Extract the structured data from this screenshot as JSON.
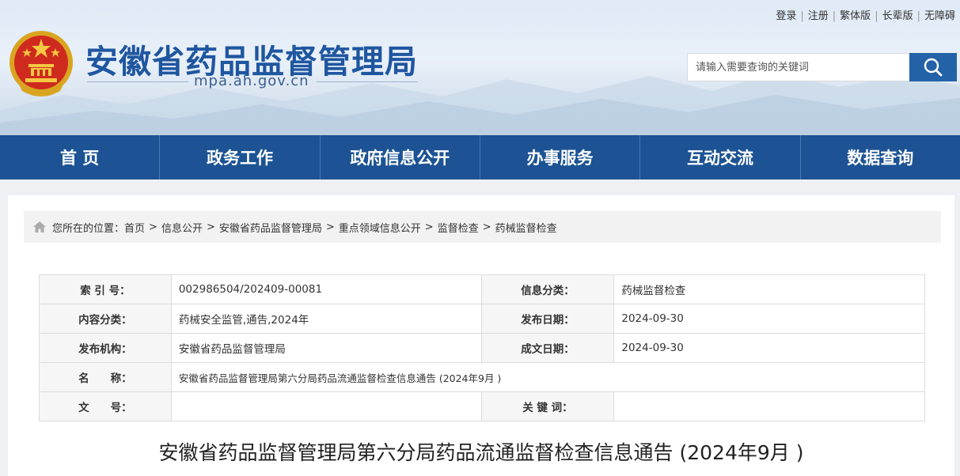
{
  "header": {
    "title": "安徽省药品监督管理局",
    "url": "mpa.ah.gov.cn",
    "toplinks": [
      "登录",
      "注册",
      "繁体版",
      "长辈版",
      "无障碍"
    ],
    "search": {
      "placeholder": "请输入需要查询的关键词"
    }
  },
  "nav": {
    "items": [
      "首 页",
      "政务工作",
      "政府信息公开",
      "办事服务",
      "互动交流",
      "数据查询"
    ]
  },
  "breadcrumb": {
    "prefix": "您所在的位置：",
    "items": [
      "首页",
      "信息公开",
      "安徽省药品监督管理局",
      "重点领域信息公开",
      "监督检查",
      "药械监督检查"
    ],
    "separator": ">"
  },
  "meta": {
    "index_label": "索 引 号：",
    "index_value": "002986504/202409-00081",
    "category_label": "信息分类：",
    "category_value": "药械监督检查",
    "content_type_label": "内容分类：",
    "content_type_value": "药械安全监管,通告,2024年",
    "publish_date_label": "发布日期：",
    "publish_date_value": "2024-09-30",
    "publisher_label": "发布机构：",
    "publisher_value": "安徽省药品监督管理局",
    "written_date_label": "成文日期：",
    "written_date_value": "2024-09-30",
    "name_label": "名　　称：",
    "name_value": "安徽省药品监督管理局第六分局药品流通监督检查信息通告 (2024年9月 )",
    "doc_no_label": "文　　号：",
    "doc_no_value": "",
    "keywords_label": "关 键 词：",
    "keywords_value": ""
  },
  "article": {
    "title": "安徽省药品监督管理局第六分局药品流通监督检查信息通告 (2024年9月 )"
  },
  "colors": {
    "brand_blue": "#1d5394",
    "title_blue": "#1f56a0",
    "search_button": "#2462a8"
  }
}
